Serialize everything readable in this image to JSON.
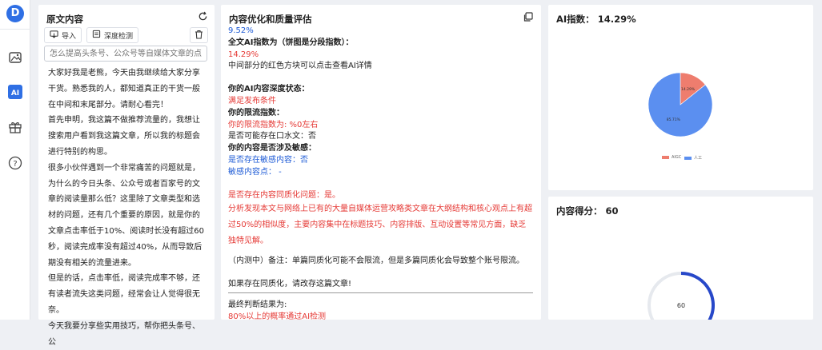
{
  "colors": {
    "accent": "#2f6fe4",
    "red": "#e53935",
    "blue": "#1e5bd6",
    "pie_ai": "#ee7d6e",
    "pie_human": "#5b8ff0"
  },
  "rail": {
    "logo": "D",
    "icons": [
      "image-icon",
      "ai-icon",
      "gift-icon",
      "help-icon"
    ]
  },
  "original": {
    "title": "原文内容",
    "import_label": "导入",
    "deep_check_label": "深度检测",
    "search_placeholder": "怎么提高头条号、公众号等自媒体文章的点",
    "paragraphs": [
      "大家好我是老熊，今天由我继续给大家分享干货。熟悉我的人，都知道真正的干货一般在中间和末尾部分。请耐心看完！",
      "首先申明，我这篇不做推荐流量的，我想让搜索用户看到我这篇文章，所以我的标题会进行特别的构思。",
      "很多小伙伴遇到一个非常痛苦的问题就是，为什么的今日头条、公众号或者百家号的文章的阅读量那么低？这里除了文章类型和选材的问题，还有几个重要的原因，就是你的文章点击率低于10%、阅读时长没有超过60秒，阅读完成率没有超过40%，从而导致后期没有相关的流量进来。",
      "但是的话，点击率低，阅读完成率不够，还有读者流失这类问题，经常会让人觉得很无奈。",
      "今天我要分享些实用技巧，帮你把头条号、公"
    ]
  },
  "optimize": {
    "title": "内容优化和质量评估",
    "lines": {
      "pct1": "9.52%",
      "ai_index_label": "全文AI指数为（饼图是分段指数）：",
      "ai_index_value": "14.29%",
      "hint": "中间部分的红色方块可以点击查看AI详情",
      "depth_label": "你的AI内容深度状态：",
      "depth_value": "满足发布条件",
      "limit_label": "你的限流指数：",
      "limit_value": "你的限流指数为: %0左右",
      "water": "是否可能存在口水文：否",
      "sensitive_label": "你的内容是否涉及敏感：",
      "sensitive_value": "是否存在敏感内容：否",
      "sensitive_points": "敏感内容点： -",
      "homog": "是否存在内容同质化问题：是。",
      "analysis": "分析发现本文与网络上已有的大量自媒体运营攻略类文章在大纲结构和核心观点上有超过50%的相似度，主要内容集中在标题技巧、内容排版、互动设置等常见方面，缺乏独特见解。",
      "note": "（内测中）备注：单篇同质化可能不会限流，但是多篇同质化会导致整个账号限流。",
      "rewrite": "如果存在同质化，请改存这篇文章!",
      "final_label": "最终判断结果为:",
      "final_value": "80%以上的概率通过AI检测"
    }
  },
  "ai_panel": {
    "title_prefix": "AI指数：",
    "title_value": "14.29%",
    "pie_labels": {
      "ai": "14.29%",
      "human": "85.71%"
    },
    "legend": [
      {
        "name": "AIGC"
      },
      {
        "name": "人工"
      }
    ]
  },
  "chart_data": {
    "type": "pie",
    "categories": [
      "AIGC",
      "人工"
    ],
    "values": [
      14.29,
      85.71
    ],
    "colors": [
      "#ee7d6e",
      "#5b8ff0"
    ]
  },
  "score_panel": {
    "title_prefix": "内容得分：",
    "title_value": "60",
    "gauge_value": "60",
    "gauge_fraction": 0.6
  }
}
